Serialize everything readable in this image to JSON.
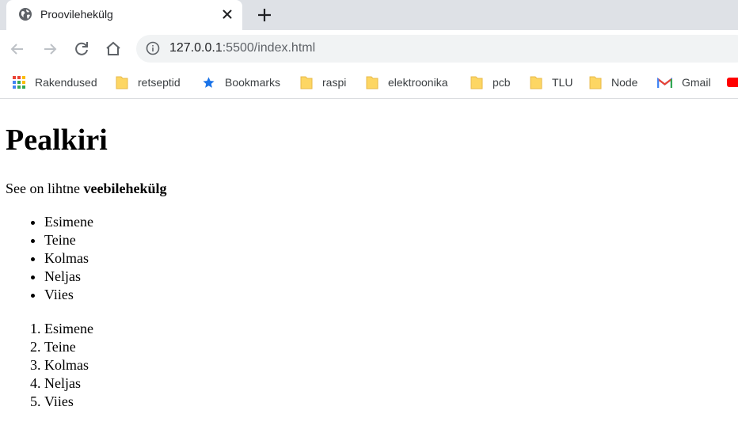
{
  "tab": {
    "title": "Proovilehekülg",
    "favicon": "globe-icon"
  },
  "address_bar": {
    "host": "127.0.0.1",
    "path": ":5500/index.html"
  },
  "bookmarks": [
    {
      "label": "Rakendused",
      "icon": "apps-grid-icon"
    },
    {
      "label": "retseptid",
      "icon": "folder-icon"
    },
    {
      "label": "Bookmarks",
      "icon": "star-icon"
    },
    {
      "label": "raspi",
      "icon": "folder-icon"
    },
    {
      "label": "elektroonika",
      "icon": "folder-icon"
    },
    {
      "label": "pcb",
      "icon": "folder-icon"
    },
    {
      "label": "TLU",
      "icon": "folder-icon"
    },
    {
      "label": "Node",
      "icon": "folder-icon"
    },
    {
      "label": "Gmail",
      "icon": "gmail-icon"
    }
  ],
  "page": {
    "heading": "Pealkiri",
    "intro_text": "See on lihtne ",
    "intro_bold": "veebilehekülg",
    "unordered_items": [
      "Esimene",
      "Teine",
      "Kolmas",
      "Neljas",
      "Viies"
    ],
    "ordered_items": [
      "Esimene",
      "Teine",
      "Kolmas",
      "Neljas",
      "Viies"
    ]
  },
  "colors": {
    "tabstrip": "#dee1e6",
    "omnibox": "#f1f3f4",
    "folder": "#fdd663",
    "star": "#1a73e8"
  }
}
